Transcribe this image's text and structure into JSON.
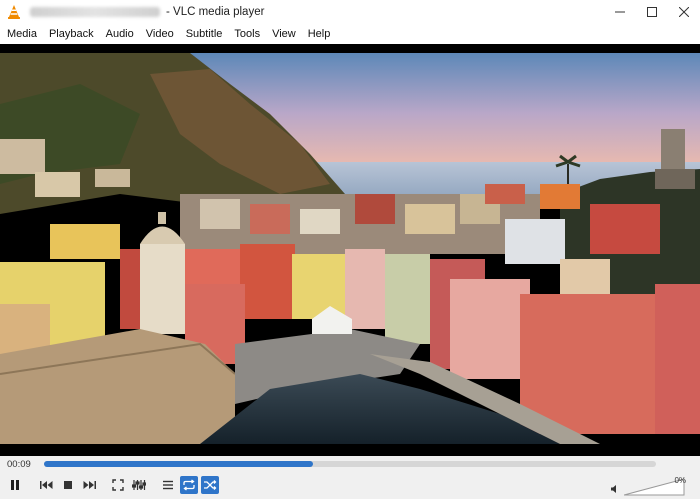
{
  "window": {
    "title": "- VLC media player"
  },
  "menu": [
    "Media",
    "Playback",
    "Audio",
    "Video",
    "Subtitle",
    "Tools",
    "View",
    "Help"
  ],
  "playback": {
    "elapsed": "00:09",
    "remaining": "",
    "progress": 0.44,
    "volume": "0%",
    "volume_level": 0
  },
  "colors": {
    "accent": "#2f75c9",
    "vlc_orange": "#f08a00"
  },
  "icons": {
    "window": [
      "minimize-icon",
      "maximize-icon",
      "close-icon"
    ],
    "controls": [
      "pause-icon",
      "previous-icon",
      "stop-icon",
      "next-icon",
      "fullscreen-icon",
      "extended-settings-icon",
      "playlist-icon",
      "loop-icon",
      "shuffle-icon",
      "volume-icon"
    ]
  }
}
